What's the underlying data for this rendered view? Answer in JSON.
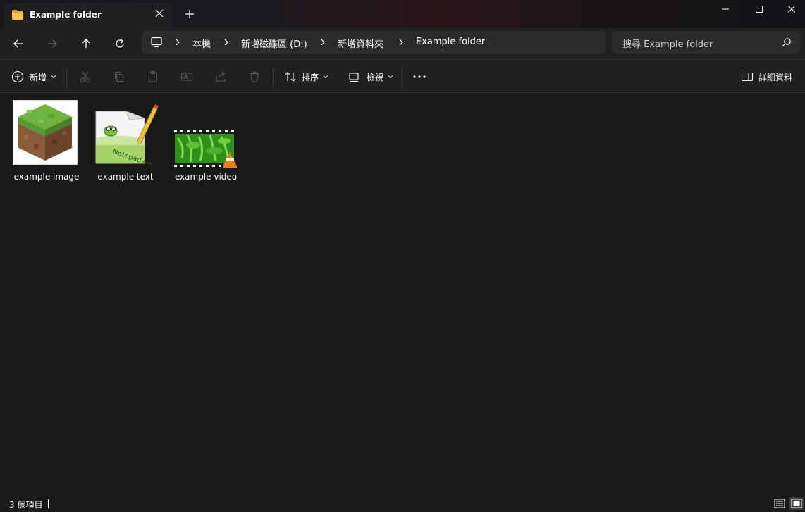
{
  "tab": {
    "title": "Example folder",
    "icon": "folder-icon"
  },
  "window": {
    "accent": "#f7c646"
  },
  "breadcrumb": {
    "items": [
      {
        "label": "本機"
      },
      {
        "label": "新增磁碟區 (D:)"
      },
      {
        "label": "新增資料夾"
      },
      {
        "label": "Example folder"
      }
    ]
  },
  "search": {
    "placeholder": "搜尋 Example folder"
  },
  "toolbar": {
    "new_label": "新增",
    "sort_label": "排序",
    "view_label": "檢視",
    "details_label": "詳細資料"
  },
  "files": [
    {
      "name": "example image",
      "icon": "image-file-icon"
    },
    {
      "name": "example text",
      "icon": "notepadpp-file-icon"
    },
    {
      "name": "example video",
      "icon": "vlc-video-file-icon"
    }
  ],
  "status": {
    "item_count": "3 個項目"
  }
}
